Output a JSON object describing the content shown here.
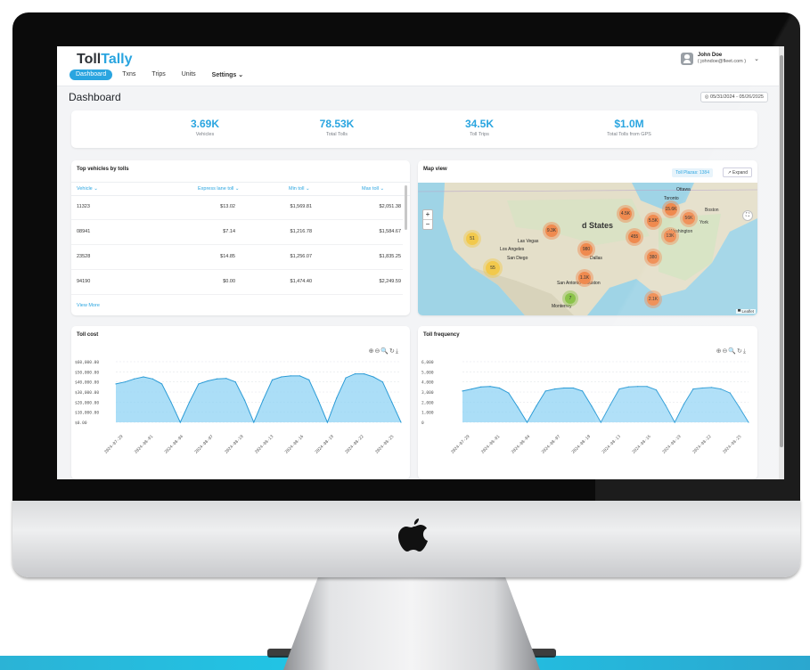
{
  "app": {
    "logo_main": "Toll",
    "logo_accent": "Tally",
    "nav": [
      "Dashboard",
      "Txns",
      "Trips",
      "Units",
      "Settings ⌄"
    ],
    "user": {
      "name": "John Doe",
      "email": "( johndoe@fleet.com )"
    },
    "page_title": "Dashboard",
    "date_range": "◎ 05/31/2024 - 05/26/2025"
  },
  "stats": [
    {
      "value": "3.69K",
      "label": "Vehicles"
    },
    {
      "value": "78.53K",
      "label": "Total Tolls"
    },
    {
      "value": "34.5K",
      "label": "Toll Trips"
    },
    {
      "value": "$1.0M",
      "label": "Total Tolls from GPS"
    }
  ],
  "top_vehicles": {
    "title": "Top vehicles by tolls",
    "columns": [
      "Vehicle ⌄",
      "Express lane toll ⌄",
      "Min toll ⌄",
      "Max toll ⌄"
    ],
    "rows": [
      [
        "11323",
        "$13.02",
        "$1,569.81",
        "$2,051.38"
      ],
      [
        "08941",
        "$7.14",
        "$1,216.78",
        "$1,584.67"
      ],
      [
        "23528",
        "$14.85",
        "$1,256.07",
        "$1,835.25"
      ],
      [
        "94190",
        "$0.00",
        "$1,474.40",
        "$2,249.59"
      ]
    ],
    "view_more": "View More"
  },
  "map": {
    "title": "Map view",
    "toll_plazas": "Toll Plazas: 1384",
    "expand": "↗ Expand",
    "zoom_in": "+",
    "zoom_out": "−",
    "attribution": "▀ Leaflet",
    "clusters": [
      "51",
      "55",
      "9.3K",
      "4.5K",
      "15.6K",
      "56K",
      "5.5K",
      "455",
      "13K",
      "980",
      "380",
      "1.1K",
      "2.1K",
      "7"
    ],
    "labels": [
      "d States",
      "Los Angeles",
      "Las Vegas",
      "San Diego",
      "Dallas",
      "Houston",
      "San Antonio",
      "Toronto",
      "Boston",
      "York",
      "Washington",
      "Ottawa",
      "Monterrey"
    ]
  },
  "toll_cost": {
    "title": "Toll cost",
    "tools": "⊕⊖🔍↻⤓"
  },
  "toll_frequency": {
    "title": "Toll frequency",
    "tools": "⊕⊖🔍↻⤓"
  },
  "chart_data": [
    {
      "type": "area",
      "title": "Toll cost",
      "y_ticks": [
        "$60,000.00",
        "$50,000.00",
        "$40,000.00",
        "$30,000.00",
        "$20,000.00",
        "$10,000.00",
        "$0.00"
      ],
      "ylim": [
        0,
        60000
      ],
      "x_ticks": [
        "2024-07-29",
        "2024-08-01",
        "2024-08-04",
        "2024-08-07",
        "2024-08-10",
        "2024-08-13",
        "2024-08-16",
        "2024-08-19",
        "2024-08-22",
        "2024-08-25"
      ],
      "values": [
        38000,
        40000,
        43000,
        45000,
        43000,
        38000,
        20000,
        0,
        20000,
        38000,
        41000,
        43000,
        43500,
        40000,
        22000,
        0,
        22000,
        42000,
        45000,
        46000,
        46000,
        42000,
        22000,
        0,
        24000,
        44000,
        48000,
        48000,
        45000,
        40000,
        20000,
        0
      ]
    },
    {
      "type": "area",
      "title": "Toll frequency",
      "y_ticks": [
        "6,000",
        "5,000",
        "4,000",
        "3,000",
        "2,000",
        "1,000",
        "0"
      ],
      "ylim": [
        0,
        6000
      ],
      "x_ticks": [
        "2024-07-29",
        "2024-08-01",
        "2024-08-04",
        "2024-08-07",
        "2024-08-10",
        "2024-08-13",
        "2024-08-16",
        "2024-08-19",
        "2024-08-22",
        "2024-08-25"
      ],
      "values": [
        3100,
        3300,
        3500,
        3550,
        3400,
        2900,
        1500,
        0,
        1600,
        3100,
        3300,
        3400,
        3400,
        3100,
        1600,
        0,
        1700,
        3300,
        3500,
        3550,
        3550,
        3200,
        1700,
        0,
        1800,
        3300,
        3400,
        3450,
        3300,
        2900,
        1500,
        0
      ]
    }
  ]
}
